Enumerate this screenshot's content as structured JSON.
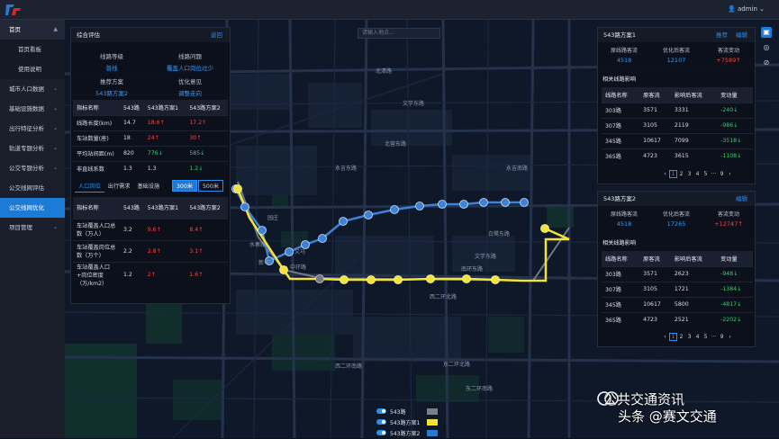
{
  "header": {
    "user": "admin"
  },
  "sidebar": {
    "items": [
      {
        "label": "首页",
        "type": "head",
        "chev": "▲"
      },
      {
        "label": "首页看板",
        "type": "sub"
      },
      {
        "label": "使用说明",
        "type": "sub"
      },
      {
        "label": "城市人口数据",
        "type": "item",
        "chev": "⌄"
      },
      {
        "label": "基础设施数据",
        "type": "item",
        "chev": "⌄"
      },
      {
        "label": "出行特征分析",
        "type": "item",
        "chev": "⌄"
      },
      {
        "label": "轨道专题分析",
        "type": "item",
        "chev": "⌄"
      },
      {
        "label": "公交专题分析",
        "type": "item",
        "chev": "⌄"
      },
      {
        "label": "公交线网评估",
        "type": "item"
      },
      {
        "label": "公交线网优化",
        "type": "active"
      },
      {
        "label": "项目管理",
        "type": "item",
        "chev": "⌄"
      }
    ]
  },
  "map": {
    "search_placeholder": "请输入地点...",
    "labels": [
      "北清路",
      "文学东路",
      "北营东路",
      "永吉东路",
      "永吉南路",
      "园庄",
      "水寨路",
      "义马",
      "白鹭东路",
      "文学东路",
      "南环东路",
      "西二环北路",
      "西二环南路",
      "东二环北路",
      "东二环南路",
      "新华",
      "中环路"
    ]
  },
  "left_panel": {
    "title": "综合评估",
    "return_label": "返回",
    "line_type_label": "线路等级",
    "line_type_value": "普线",
    "line_problem_label": "线路问题",
    "line_problem_value": "覆盖人口岗位过少",
    "recommend_label": "推荐方案",
    "recommend_value": "543路方案2",
    "opt_label": "优化意见",
    "opt_value": "调整走向",
    "table1": {
      "headers": [
        "指标名称",
        "543路",
        "543路方案1",
        "543路方案2"
      ],
      "rows": [
        [
          "线路长度(km)",
          "14.7",
          "18.6↑",
          "17.2↑"
        ],
        [
          "车站数量(座)",
          "18",
          "24↑",
          "30↑"
        ],
        [
          "平均站间距(m)",
          "820",
          "776↓",
          "585↓"
        ],
        [
          "非直线系数",
          "1.3",
          "1.3",
          "1.2↓"
        ]
      ]
    },
    "tabs": [
      "人口岗位",
      "出行需求",
      "基础设施"
    ],
    "segments": [
      "300米",
      "500米"
    ],
    "table2": {
      "headers": [
        "指标名称",
        "543路",
        "543路方案1",
        "543路方案2"
      ],
      "rows": [
        [
          "车站覆盖人口总数（万人）",
          "3.2",
          "9.6↑",
          "8.4↑"
        ],
        [
          "车站覆盖岗位总数（万个）",
          "2.2",
          "2.8↑",
          "3.1↑"
        ],
        [
          "车站覆盖人口+岗位密度（万/km2）",
          "1.2",
          "2↑",
          "1.6↑"
        ]
      ]
    }
  },
  "right_panel_1": {
    "title": "543路方案1",
    "action_1": "推荐",
    "action_2": "编辑",
    "stats": [
      {
        "k": "原线路客流",
        "v": "4518",
        "color": "#3a9bf5"
      },
      {
        "k": "优化后客流",
        "v": "12107",
        "color": "#3a9bf5"
      },
      {
        "k": "客流变动",
        "v": "+7589↑",
        "color": "#ff4242"
      }
    ],
    "section": "相关线路影响",
    "headers": [
      "线路名称",
      "原客流",
      "影响后客流",
      "变动量"
    ],
    "rows": [
      [
        "303路",
        "3571",
        "3331",
        "-240↓"
      ],
      [
        "307路",
        "3105",
        "2119",
        "-986↓"
      ],
      [
        "345路",
        "10617",
        "7099",
        "-3518↓"
      ],
      [
        "365路",
        "4723",
        "3615",
        "-1108↓"
      ]
    ],
    "pager": [
      "‹",
      "1",
      "2",
      "3",
      "4",
      "5",
      "···",
      "9",
      "›"
    ]
  },
  "right_panel_2": {
    "title": "543路方案2",
    "action_1": "编辑",
    "stats": [
      {
        "k": "原线路客流",
        "v": "4518",
        "color": "#3a9bf5"
      },
      {
        "k": "优化后客流",
        "v": "17265",
        "color": "#3a9bf5"
      },
      {
        "k": "客流变动",
        "v": "+12747↑",
        "color": "#ff4242"
      }
    ],
    "section": "相关线路影响",
    "headers": [
      "线路名称",
      "原客流",
      "影响后客流",
      "变动量"
    ],
    "rows": [
      [
        "303路",
        "3571",
        "2623",
        "-948↓"
      ],
      [
        "307路",
        "3105",
        "1721",
        "-1384↓"
      ],
      [
        "345路",
        "10617",
        "5800",
        "-4817↓"
      ],
      [
        "365路",
        "4723",
        "2521",
        "-2202↓"
      ]
    ],
    "pager": [
      "‹",
      "1",
      "2",
      "3",
      "4",
      "5",
      "···",
      "9",
      "›"
    ]
  },
  "legend": [
    {
      "label": "543路",
      "color": "#7a7f88"
    },
    {
      "label": "543路方案1",
      "color": "#f2e33a"
    },
    {
      "label": "543路方案2",
      "color": "#2b7ad0"
    }
  ],
  "watermark": {
    "line1": "公共交通资讯",
    "line2": "头条 @赛文交通"
  },
  "colors": {
    "accent": "#1b7bd6",
    "route_plan1": "#f2e33a",
    "route_plan2": "#3d82d6",
    "increase": "#ff4242",
    "decrease": "#2ed36c"
  }
}
